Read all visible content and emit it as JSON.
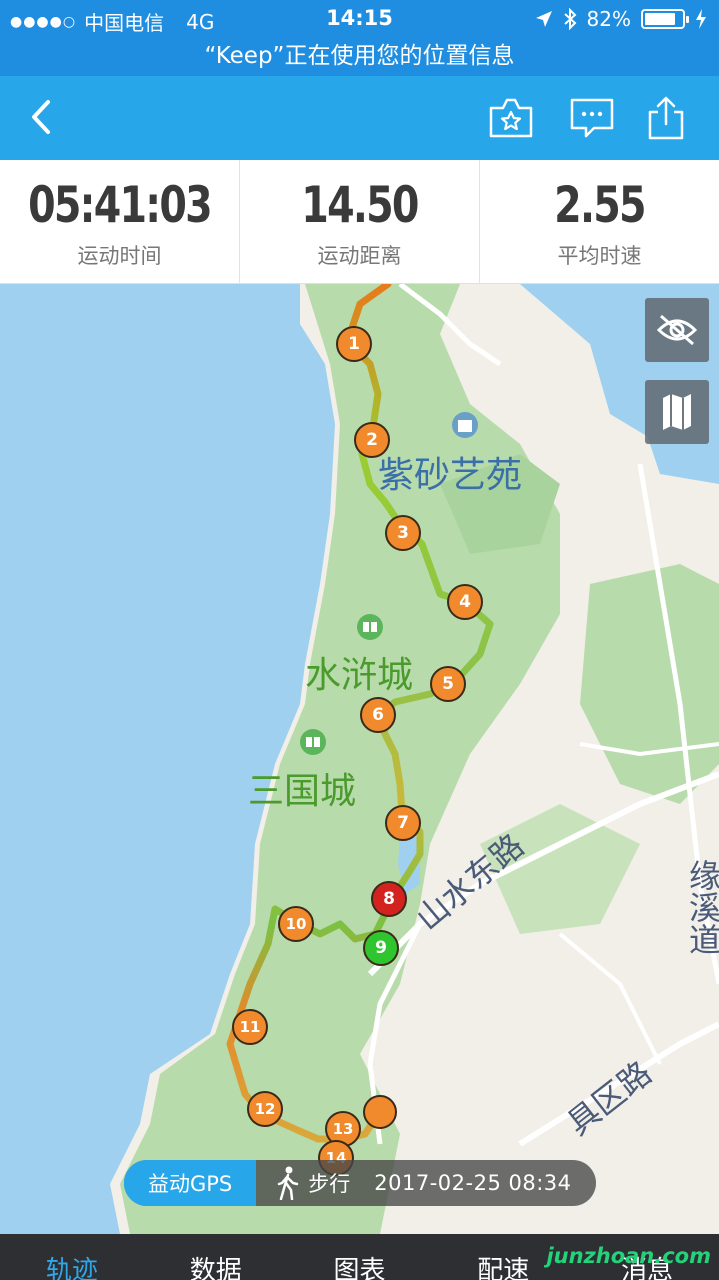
{
  "status_bar": {
    "carrier": "中国电信",
    "network": "4G",
    "time": "14:15",
    "battery": "82%",
    "battery_level": 0.82
  },
  "location_notice": "“Keep”正在使用您的位置信息",
  "stats": [
    {
      "value": "05:41:03",
      "label": "运动时间"
    },
    {
      "value": "14.50",
      "label": "运动距离"
    },
    {
      "value": "2.55",
      "label": "平均时速"
    }
  ],
  "map": {
    "places": {
      "zisha": "紫砂艺苑",
      "shuihu": "水浒城",
      "sanguo": "三国城",
      "shanshui": "山水东路",
      "juqu": "具区路",
      "xiwei": "缘溪道"
    },
    "km_markers": [
      "1",
      "2",
      "3",
      "4",
      "5",
      "6",
      "7",
      "8",
      "9",
      "10",
      "11",
      "12",
      "13",
      "14"
    ],
    "colors": {
      "water": "#9fd0f0",
      "land": "#f1efe8",
      "park": "#b8dbac",
      "marker_orange": "#f08a2c",
      "marker_red": "#d3231f",
      "marker_green": "#2fc52f",
      "accent": "#27a6ea"
    }
  },
  "info_pill": {
    "gps": "益动GPS",
    "mode": "步行",
    "datetime": "2017-02-25 08:34"
  },
  "tabs": [
    {
      "label": "轨迹"
    },
    {
      "label": "数据"
    },
    {
      "label": "图表"
    },
    {
      "label": "配速"
    },
    {
      "label": "消息"
    }
  ],
  "watermark": "junzhoan.com"
}
